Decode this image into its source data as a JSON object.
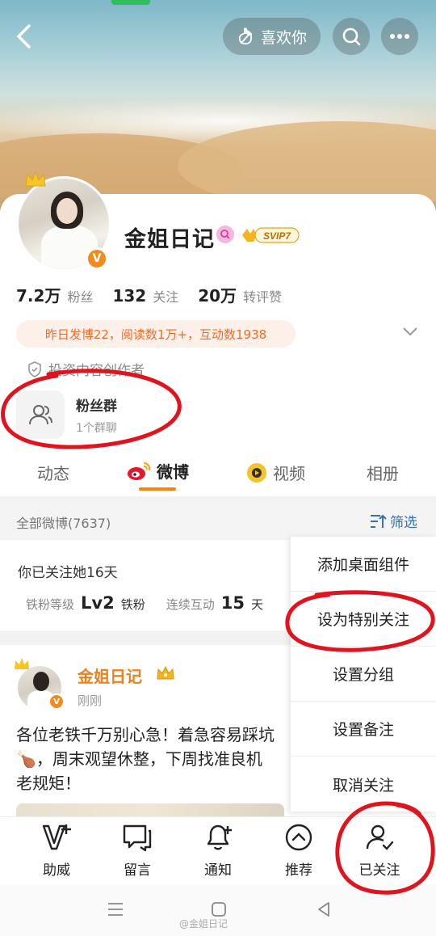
{
  "header": {
    "like_label": "喜欢你"
  },
  "profile": {
    "name": "金姐日记",
    "vip_badge": "SVIP7",
    "stats": [
      {
        "value": "7.2万",
        "label": "粉丝"
      },
      {
        "value": "132",
        "label": "关注"
      },
      {
        "value": "20万",
        "label": "转评赞"
      }
    ],
    "activity": "昨日发博22，阅读数1万+，互动数1938",
    "creator_tag": "投资内容创作者",
    "fans_group": {
      "title": "粉丝群",
      "subtitle": "1个群聊"
    }
  },
  "tabs": [
    {
      "label": "动态"
    },
    {
      "label": "微博"
    },
    {
      "label": "视频"
    },
    {
      "label": "相册"
    }
  ],
  "filter": {
    "label": "全部微博(7637)",
    "button": "筛选"
  },
  "follow_info": {
    "days": "你已关注她16天",
    "level_label": "铁粉等级",
    "level_value": "Lv2",
    "level_name": "铁粉",
    "streak_label": "连续互动",
    "streak_value": "15",
    "streak_unit": "天"
  },
  "post": {
    "author": "金姐日记",
    "time": "刚刚",
    "text_line1": "各位老铁千万别心急！着急容易踩坑",
    "text_line2": "，周末观望休整，下周找准良机",
    "text_line3": "老规矩！"
  },
  "menu": {
    "items": [
      "添加桌面组件",
      "设为特别关注",
      "设置分组",
      "设置备注",
      "取消关注"
    ]
  },
  "bottom_bar": {
    "items": [
      "助威",
      "留言",
      "通知",
      "推荐",
      "已关注"
    ]
  },
  "watermark": "@金姐日记",
  "colors": {
    "accent": "#ff8200",
    "link": "#3570b5",
    "annotation": "#e0141e"
  }
}
